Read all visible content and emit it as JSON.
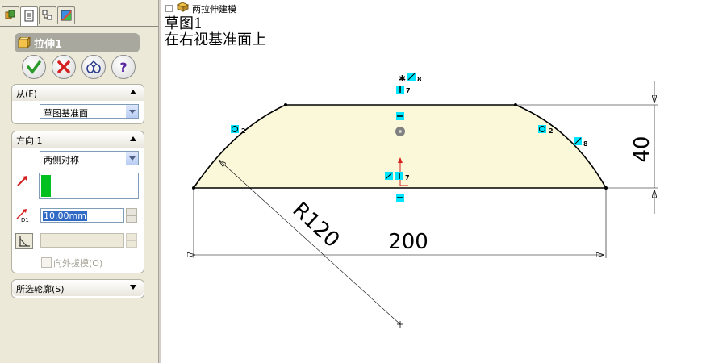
{
  "tree": {
    "node_label": "两拉伸建模"
  },
  "notes": {
    "line1": "草图1",
    "line2": "在右视基准面上"
  },
  "feature": {
    "title": "拉伸1"
  },
  "buttons": {
    "ok": "ok-icon",
    "cancel": "cancel-icon",
    "preview": "preview-icon",
    "help": "?"
  },
  "from_group": {
    "title": "从(F)",
    "value": "草图基准面"
  },
  "direction_group": {
    "title": "方向 1",
    "end_condition": "两侧对称",
    "depth_value": "10.00mm",
    "depth_icon_label": "D1",
    "draft_label": "向外拔模(O)"
  },
  "contours_group": {
    "title": "所选轮廓(S)"
  },
  "sketch": {
    "dim_width": "200",
    "dim_height": "40",
    "dim_radius": "R120",
    "relation_labels": [
      "8",
      "7",
      "2",
      "2",
      "8",
      "7"
    ]
  },
  "colors": {
    "profile_fill": "#fbf8d9",
    "relation_marker": "#00e5ff",
    "panel_bg": "#ece9d8"
  }
}
